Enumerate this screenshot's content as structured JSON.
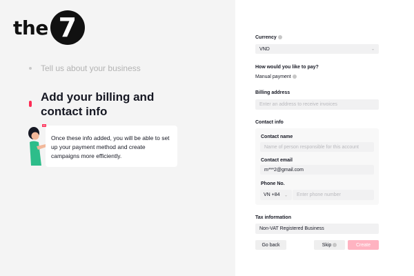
{
  "brand": {
    "logo_text": "the",
    "logo_number": "7"
  },
  "steps": {
    "previous": "Tell us about your business",
    "current_title": "Add your billing and contact info",
    "tip": "Once these info added, you will be able to set up your payment method and create campaigns more efficiently."
  },
  "form": {
    "currency_label": "Currency",
    "currency_value": "VND",
    "payment_question": "How would you like to pay?",
    "payment_method": "Manual payment",
    "billing_label": "Billing address",
    "billing_placeholder": "Enter an address to receive invoices",
    "contact_section": "Contact info",
    "contact_name_label": "Contact name",
    "contact_name_placeholder": "Name of person responsible for this account",
    "contact_email_label": "Contact email",
    "contact_email_value": "m***2@gmail.com",
    "phone_label": "Phone No.",
    "phone_code": "VN +84",
    "phone_placeholder": "Enter phone number",
    "tax_label": "Tax information",
    "tax_value": "Non-VAT Registered Business"
  },
  "buttons": {
    "back": "Go back",
    "skip": "Skip",
    "create": "Create"
  },
  "colors": {
    "accent": "#fe2c55",
    "accent_disabled": "#ffb3c1",
    "left_panel_bg": "#f4f4f4",
    "illustration_green": "#2dbd8a"
  }
}
